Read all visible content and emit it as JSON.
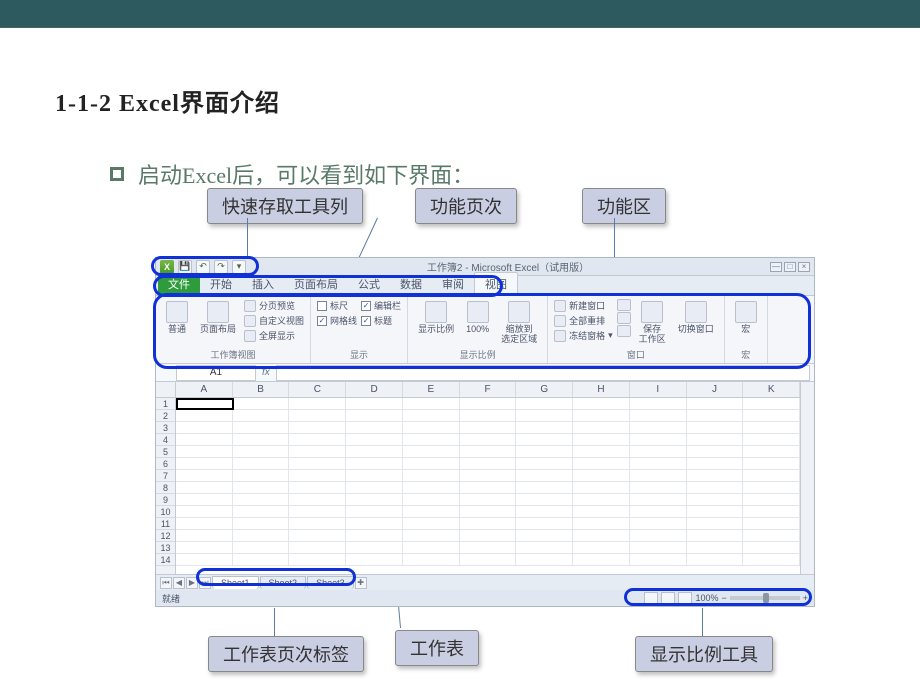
{
  "slide": {
    "title": "1-1-2 Excel界面介绍",
    "bullet": "启动Excel后，可以看到如下界面："
  },
  "callouts": {
    "qat": "快速存取工具列",
    "tabs": "功能页次",
    "ribbon": "功能区",
    "sheettabs": "工作表页次标签",
    "worksheet": "工作表",
    "zoom": "显示比例工具"
  },
  "excel": {
    "title": "工作簿2 - Microsoft Excel（试用版）",
    "tabs": {
      "file": "文件",
      "home": "开始",
      "insert": "插入",
      "layout": "页面布局",
      "formula": "公式",
      "data": "数据",
      "review": "审阅",
      "view": "视图"
    },
    "ribbon": {
      "group_views": "工作簿视图",
      "group_show": "显示",
      "group_zoom": "显示比例",
      "group_window": "窗口",
      "btn_normal": "普通",
      "btn_pagelayout": "页面布局",
      "btn_pagebreak": "分页预览",
      "btn_custom": "自定义视图",
      "btn_fullscreen": "全屏显示",
      "chk_ruler": "标尺",
      "chk_formulabar": "编辑栏",
      "chk_grid": "网格线",
      "chk_headings": "标题",
      "btn_zoom": "显示比例",
      "btn_100": "100%",
      "btn_zoomsel": "缩放到\n选定区域",
      "btn_newwin": "新建窗口",
      "btn_arrange": "全部重排",
      "btn_freeze": "冻结窗格",
      "btn_save_ws": "保存\n工作区",
      "btn_switch": "切换窗口",
      "btn_macro": "宏",
      "group_macro": "宏"
    },
    "namebox": "A1",
    "fx": "fx",
    "columns": [
      "A",
      "B",
      "C",
      "D",
      "E",
      "F",
      "G",
      "H",
      "I",
      "J",
      "K"
    ],
    "rows": [
      "1",
      "2",
      "3",
      "4",
      "5",
      "6",
      "7",
      "8",
      "9",
      "10",
      "11",
      "12",
      "13",
      "14"
    ],
    "sheets": {
      "s1": "Sheet1",
      "s2": "Sheet2",
      "s3": "Sheet3"
    },
    "status": "就绪",
    "zoom_pct": "100%"
  }
}
